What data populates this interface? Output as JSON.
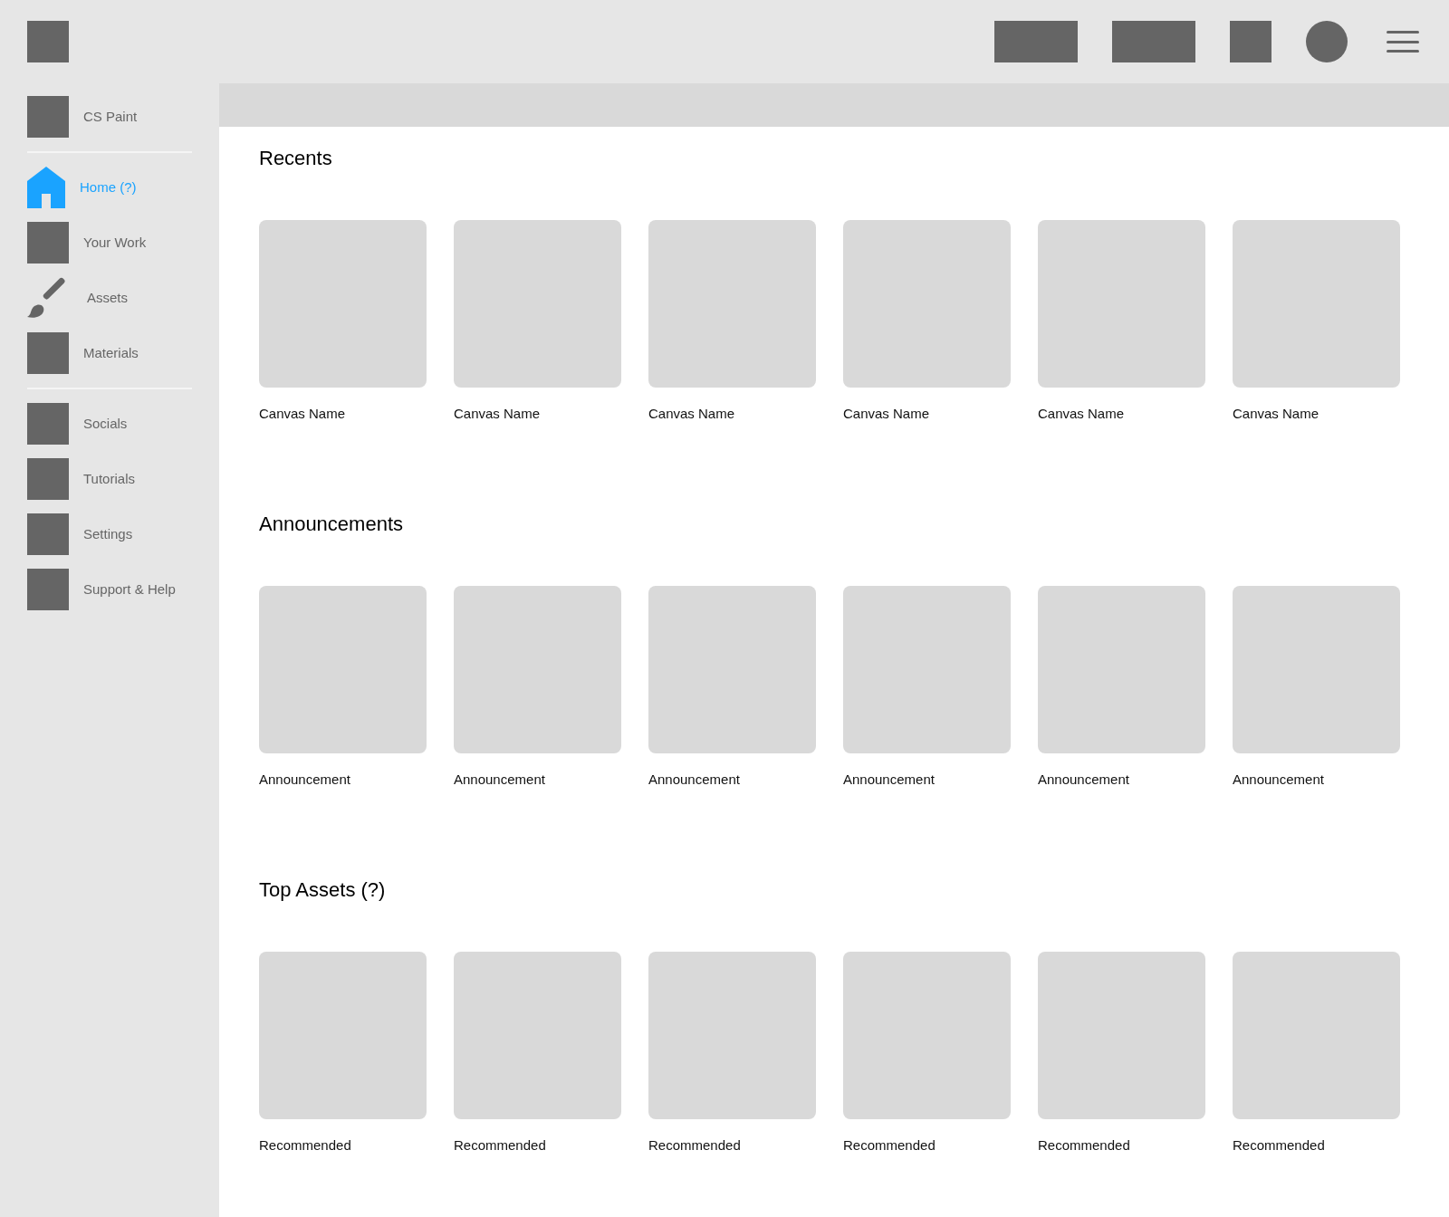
{
  "brand": {
    "label": "CS Paint"
  },
  "sidebar": {
    "groups": [
      {
        "items": [
          {
            "label": "Home (?)",
            "kind": "home",
            "selected": true
          },
          {
            "label": "Your Work",
            "kind": "square",
            "selected": false
          },
          {
            "label": "Assets",
            "kind": "brush",
            "selected": false
          },
          {
            "label": "Materials",
            "kind": "square",
            "selected": false
          }
        ]
      },
      {
        "items": [
          {
            "label": "Socials",
            "kind": "square",
            "selected": false
          },
          {
            "label": "Tutorials",
            "kind": "square",
            "selected": false
          },
          {
            "label": "Settings",
            "kind": "square",
            "selected": false
          },
          {
            "label": "Support & Help",
            "kind": "square",
            "selected": false
          }
        ]
      }
    ]
  },
  "sections": [
    {
      "title": "Recents",
      "cards": [
        "Canvas Name",
        "Canvas Name",
        "Canvas Name",
        "Canvas Name",
        "Canvas Name",
        "Canvas Name"
      ]
    },
    {
      "title": "Announcements",
      "cards": [
        "Announcement",
        "Announcement",
        "Announcement",
        "Announcement",
        "Announcement",
        "Announcement"
      ]
    },
    {
      "title": "Top Assets (?)",
      "cards": [
        "Recommended",
        "Recommended",
        "Recommended",
        "Recommended",
        "Recommended",
        "Recommended"
      ]
    }
  ]
}
